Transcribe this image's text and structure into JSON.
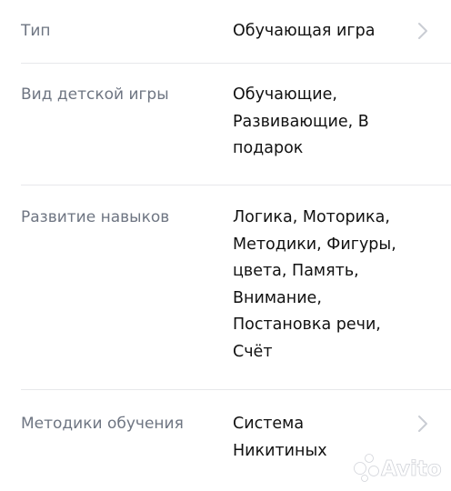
{
  "rows": [
    {
      "label": "Тип",
      "value": "Обучающая игра",
      "has_chevron": true
    },
    {
      "label": "Вид детской игры",
      "value": "Обучающие,\nРазвивающие, В\nподарок",
      "has_chevron": false
    },
    {
      "label": "Развитие навыков",
      "value": "Логика, Моторика,\nМетодики, Фигуры,\nцвета, Память,\nВнимание,\nПостановка речи,\nСчёт",
      "has_chevron": false
    },
    {
      "label": "Методики обучения",
      "value": "Система\nНикитиных",
      "has_chevron": true
    }
  ],
  "icons": {
    "row_chevron": "chevron-right-icon"
  },
  "watermark": {
    "text": "Avito"
  },
  "colors": {
    "label": "#6e7582",
    "value": "#111111",
    "divider": "#e7e8eb",
    "chevron": "#c9ccd3",
    "watermark": "#ffffff"
  }
}
